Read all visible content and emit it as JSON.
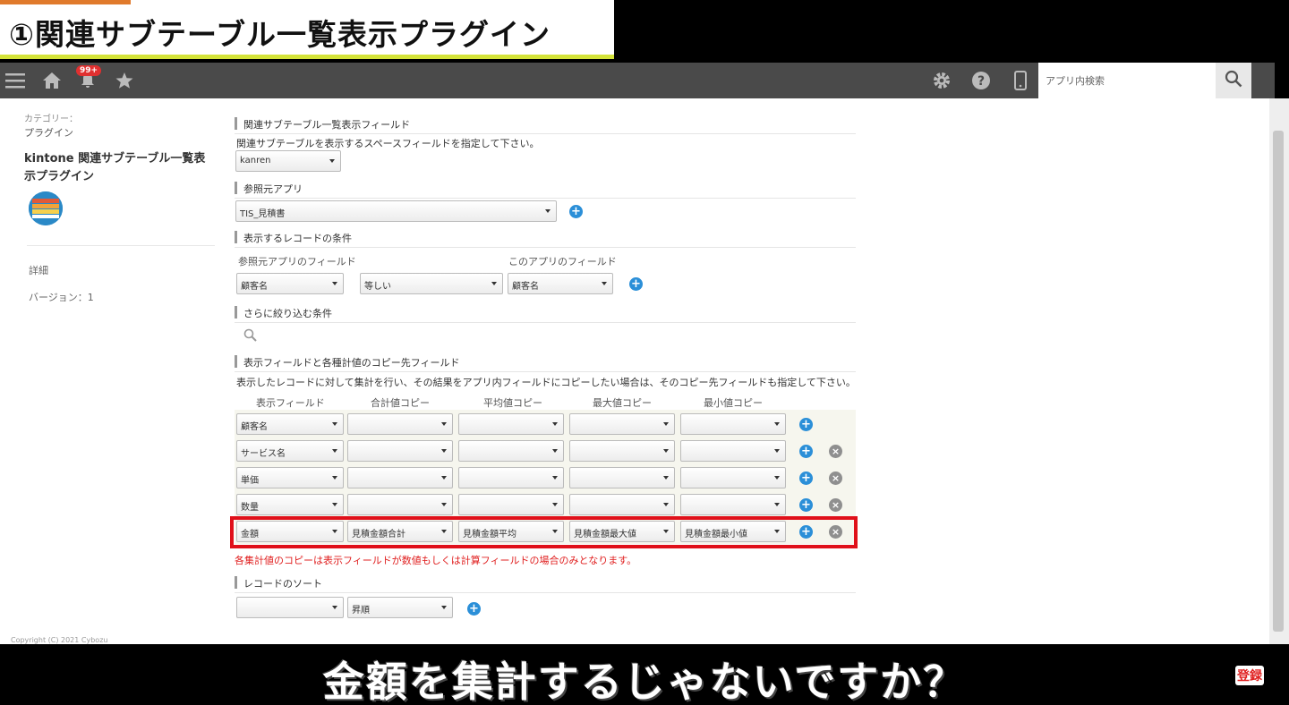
{
  "banner": {
    "title": "①関連サブテーブル一覧表示プラグイン"
  },
  "header": {
    "badge": "99+",
    "search_placeholder": "アプリ内検索"
  },
  "sidebar": {
    "category_label": "カテゴリー：",
    "category_value": "プラグイン",
    "plugin_title": "kintone 関連サブテーブル一覧表示プラグイン",
    "detail": "詳細",
    "version": "バージョン：1"
  },
  "section1": {
    "heading": "関連サブテーブル一覧表示フィールド",
    "description": "関連サブテーブルを表示するスペースフィールドを指定して下さい。",
    "select": "kanren"
  },
  "section2": {
    "heading": "参照元アプリ",
    "select": "TIS_見積書"
  },
  "section3": {
    "heading": "表示するレコードの条件",
    "col_source": "参照元アプリのフィールド",
    "col_this": "このアプリのフィールド",
    "source_field": "顧客名",
    "operator": "等しい",
    "this_field": "顧客名"
  },
  "section4": {
    "heading": "さらに絞り込む条件"
  },
  "section5": {
    "heading": "表示フィールドと各種計値のコピー先フィールド",
    "description": "表示したレコードに対して集計を行い、その結果をアプリ内フィールドにコピーしたい場合は、そのコピー先フィールドも指定して下さい。",
    "columns": [
      "表示フィールド",
      "合計値コピー",
      "平均値コピー",
      "最大値コピー",
      "最小値コピー"
    ],
    "rows": [
      [
        "顧客名",
        "",
        "",
        "",
        ""
      ],
      [
        "サービス名",
        "",
        "",
        "",
        ""
      ],
      [
        "単価",
        "",
        "",
        "",
        ""
      ],
      [
        "数量",
        "",
        "",
        "",
        ""
      ],
      [
        "金額",
        "見積金額合計",
        "見積金額平均",
        "見積金額最大値",
        "見積金額最小値"
      ]
    ],
    "note": "各集計値のコピーは表示フィールドが数値もしくは計算フィールドの場合のみとなります。"
  },
  "section6": {
    "heading": "レコードのソート",
    "field": "",
    "order": "昇順"
  },
  "footer": {
    "copyright": "Copyright (C) 2021 Cybozu"
  },
  "caption": {
    "text": "金額を集計するじゃないですか？",
    "logo": "登録"
  }
}
